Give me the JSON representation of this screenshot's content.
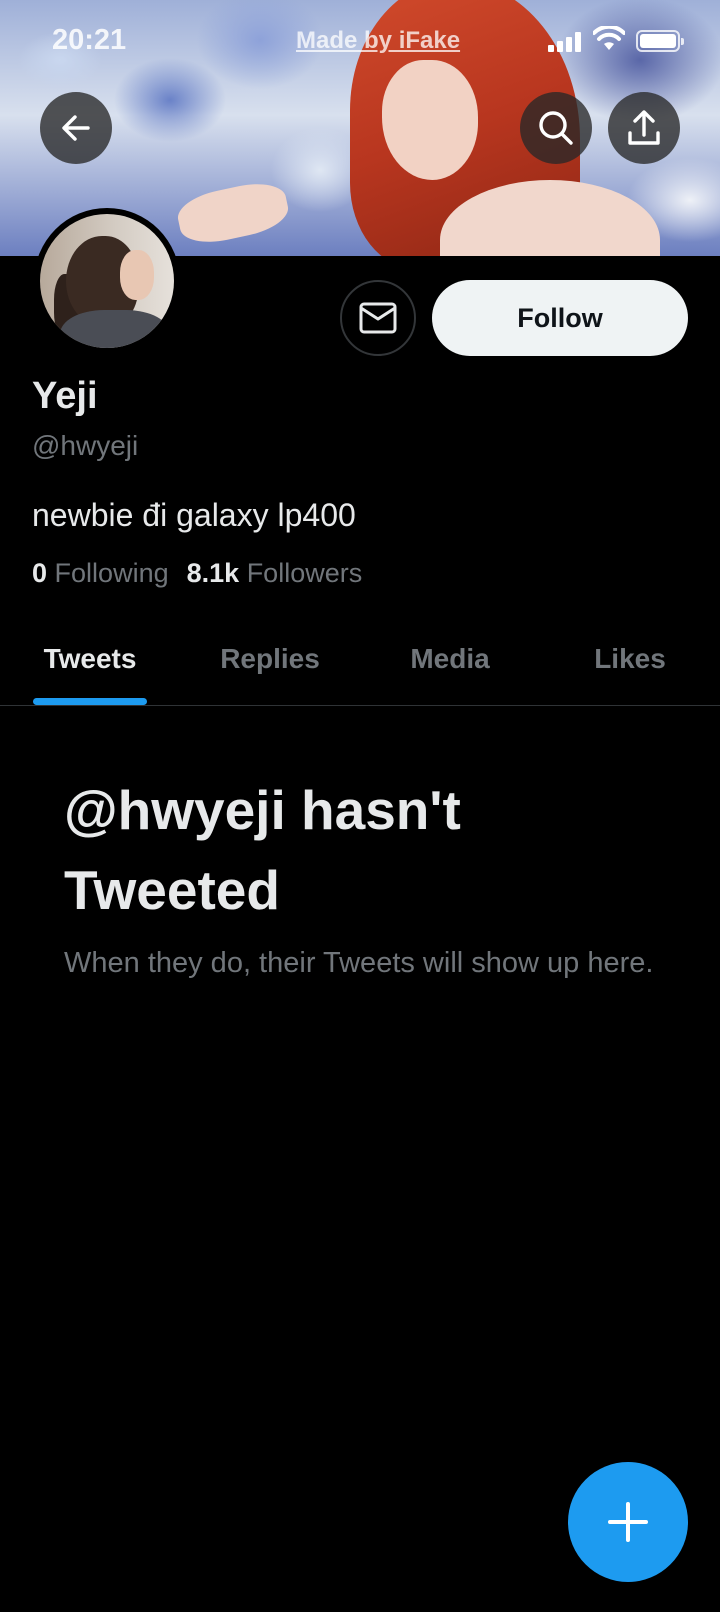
{
  "status_bar": {
    "time": "20:21",
    "carrier": "Made by iFake"
  },
  "nav": {
    "back_icon": "arrow-left-icon",
    "search_icon": "search-icon",
    "share_icon": "share-upload-icon"
  },
  "profile": {
    "name": "Yeji",
    "handle": "@hwyeji",
    "bio": "newbie đi galaxy lp400",
    "following_count": "0",
    "following_label": "Following",
    "followers_count": "8.1k",
    "followers_label": "Followers",
    "follow_button": "Follow",
    "message_icon": "envelope-icon"
  },
  "tabs": [
    {
      "label": "Tweets",
      "active": true
    },
    {
      "label": "Replies",
      "active": false
    },
    {
      "label": "Media",
      "active": false
    },
    {
      "label": "Likes",
      "active": false
    }
  ],
  "empty_state": {
    "title": "@hwyeji hasn't Tweeted",
    "subtitle": "When they do, their Tweets will show up here."
  },
  "fab": {
    "icon": "plus-icon"
  },
  "colors": {
    "accent": "#1d9bf0",
    "background": "#000000",
    "secondary_text": "#71767b",
    "primary_text": "#e7e9ea"
  }
}
